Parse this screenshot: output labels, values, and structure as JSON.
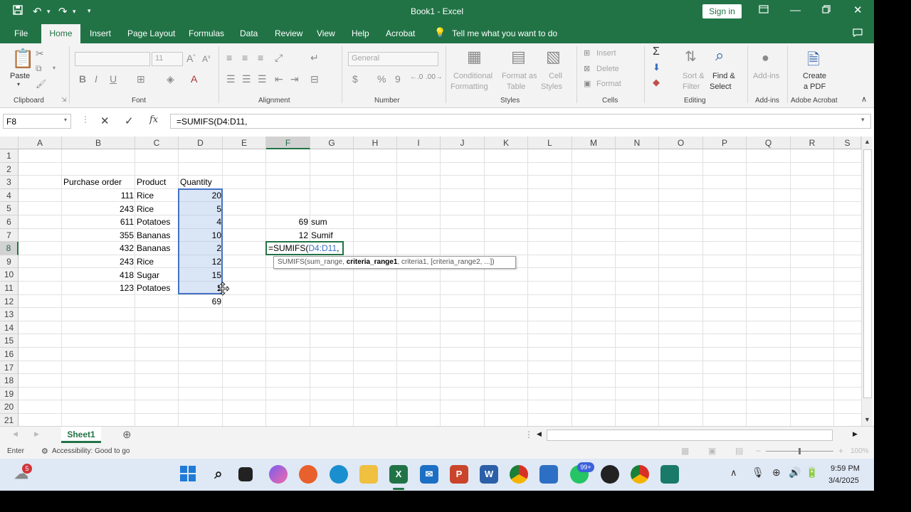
{
  "title_bar": {
    "title": "Book1  -  Excel",
    "sign_in": "Sign in"
  },
  "menu": {
    "tabs": [
      "File",
      "Home",
      "Insert",
      "Page Layout",
      "Formulas",
      "Data",
      "Review",
      "View",
      "Help",
      "Acrobat"
    ],
    "tell_me": "Tell me what you want to do"
  },
  "ribbon": {
    "clipboard": {
      "paste": "Paste",
      "label": "Clipboard"
    },
    "font": {
      "size": "11",
      "bold": "B",
      "italic": "I",
      "underline": "U",
      "label": "Font"
    },
    "alignment": {
      "label": "Alignment"
    },
    "number": {
      "format": "General",
      "currency": "$",
      "percent": "%",
      "comma": "9",
      "label": "Number"
    },
    "styles": {
      "conditional": "Conditional",
      "formatting": "Formatting",
      "format_as": "Format as",
      "table": "Table",
      "cell": "Cell",
      "cell_styles": "Styles",
      "label": "Styles"
    },
    "cells": {
      "insert": "Insert",
      "delete": "Delete",
      "format": "Format",
      "label": "Cells"
    },
    "editing": {
      "sort": "Sort &",
      "filter": "Filter",
      "find": "Find &",
      "select": "Select",
      "label": "Editing"
    },
    "addins": {
      "button": "Add-ins",
      "label": "Add-ins"
    },
    "acrobat": {
      "create": "Create",
      "pdf": "a PDF",
      "label": "Adobe Acrobat"
    }
  },
  "formula_bar": {
    "name_box": "F8",
    "fx": "fx",
    "formula": "=SUMIFS(D4:D11,"
  },
  "columns": [
    "A",
    "B",
    "C",
    "D",
    "E",
    "F",
    "G",
    "H",
    "I",
    "J",
    "K",
    "L",
    "M",
    "N",
    "O",
    "P",
    "Q",
    "R",
    "S"
  ],
  "rows": [
    "1",
    "2",
    "3",
    "4",
    "5",
    "6",
    "7",
    "8",
    "9",
    "10",
    "11",
    "12",
    "13",
    "14",
    "15",
    "16",
    "17",
    "18",
    "19",
    "20",
    "21"
  ],
  "sheet": {
    "headers": {
      "b": "Purchase order",
      "c": "Product",
      "d": "Quantity"
    },
    "records": [
      {
        "po": "111",
        "product": "Rice",
        "qty": "20"
      },
      {
        "po": "243",
        "product": "Rice",
        "qty": "5"
      },
      {
        "po": "611",
        "product": "Potatoes",
        "qty": "4"
      },
      {
        "po": "355",
        "product": "Bananas",
        "qty": "10"
      },
      {
        "po": "432",
        "product": "Bananas",
        "qty": "2"
      },
      {
        "po": "243",
        "product": "Rice",
        "qty": "12"
      },
      {
        "po": "418",
        "product": "Sugar",
        "qty": "15"
      },
      {
        "po": "123",
        "product": "Potatoes",
        "qty": "1"
      }
    ],
    "total": "69",
    "f6": "69",
    "g6": "sum",
    "f7": "12",
    "g7": "Sumif",
    "editing_prefix": "=SUMIFS(",
    "editing_ref": "D4:D11",
    "editing_suffix": ",",
    "tooltip": {
      "fn": "SUMIFS(sum_range, ",
      "bold": "criteria_range1",
      "rest": ", criteria1, [criteria_range2, ...])"
    }
  },
  "sheet_tabs": {
    "active": "Sheet1"
  },
  "status": {
    "mode": "Enter",
    "accessibility": "Accessibility: Good to go",
    "zoom": "100%"
  },
  "taskbar": {
    "weather_badge": "5",
    "chat_badge": "99+",
    "time": "9:59 PM",
    "date": "3/4/2025"
  },
  "colors": {
    "excel_green": "#217346",
    "selection_blue": "#4472c4",
    "ref_blue": "#3a6fc4"
  }
}
